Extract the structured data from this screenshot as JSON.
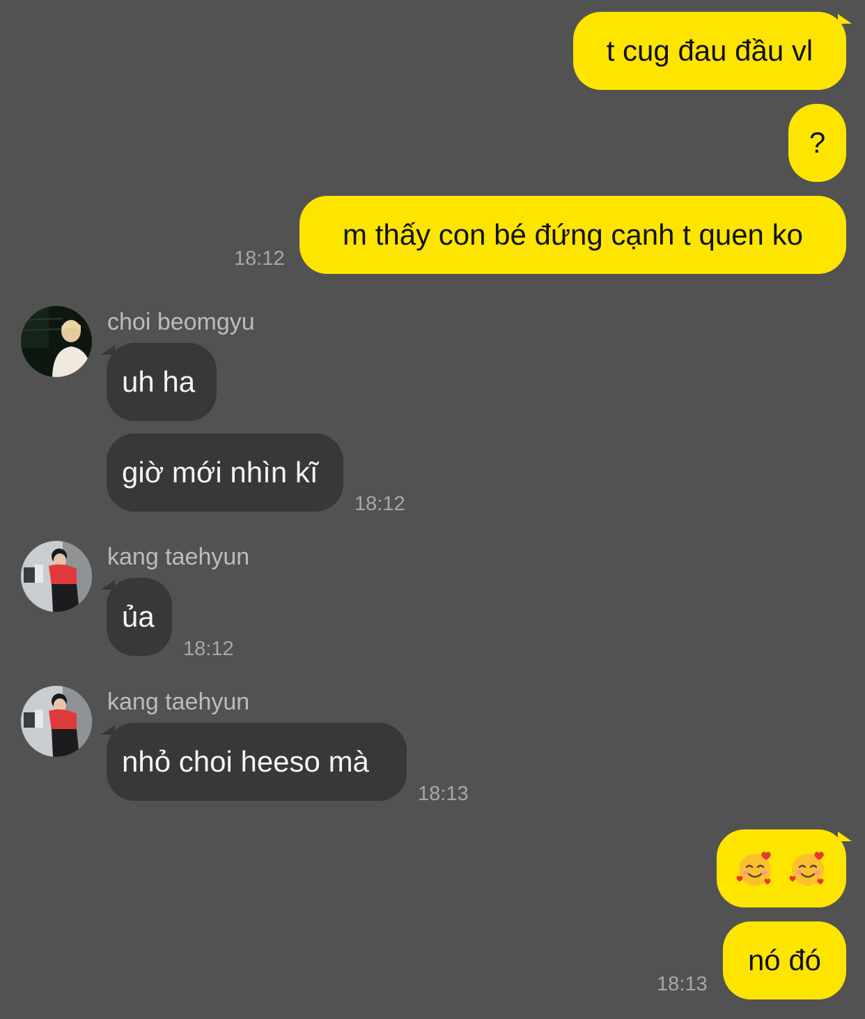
{
  "chat": {
    "messages": [
      {
        "direction": "out",
        "text": "t cug đau đầu vl"
      },
      {
        "direction": "out",
        "text": "?"
      },
      {
        "direction": "out",
        "text": "m thấy con bé đứng cạnh t quen ko",
        "time": "18:12"
      },
      {
        "direction": "in",
        "sender": "choi beomgyu",
        "text": "uh ha"
      },
      {
        "direction": "in",
        "sender": "choi beomgyu",
        "text": "giờ mới nhìn kĩ",
        "time": "18:12"
      },
      {
        "direction": "in",
        "sender": "kang taehyun",
        "text": "ủa",
        "time": "18:12"
      },
      {
        "direction": "in",
        "sender": "kang taehyun",
        "text": "nhỏ choi heeso mà",
        "time": "18:13"
      },
      {
        "direction": "out",
        "emoji": [
          "smiling-face-with-hearts",
          "smiling-face-with-hearts"
        ]
      },
      {
        "direction": "out",
        "text": "nó đó",
        "time": "18:13"
      }
    ],
    "colors": {
      "background": "#535253",
      "outgoing_bubble": "#fee500",
      "incoming_bubble": "#383739",
      "timestamp": "#a8a7a8",
      "sender_name": "#bdbcbd"
    }
  }
}
